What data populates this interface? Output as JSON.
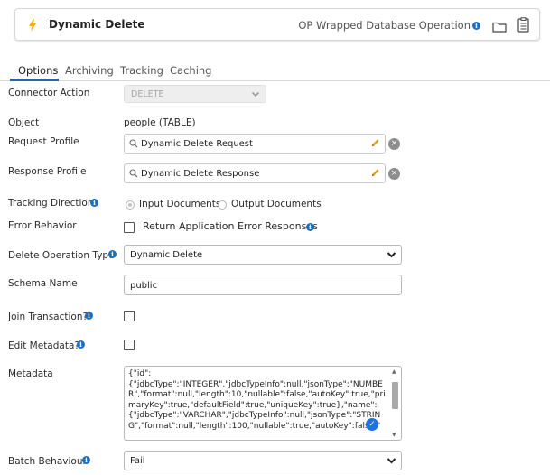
{
  "header": {
    "title": "Dynamic Delete",
    "subtitle": "OP Wrapped Database Operation",
    "icons": [
      "lightning-bolt-icon",
      "info-icon",
      "folder-icon",
      "clipboard-icon"
    ]
  },
  "tabs": [
    {
      "label": "Options",
      "active": true
    },
    {
      "label": "Archiving",
      "active": false
    },
    {
      "label": "Tracking",
      "active": false
    },
    {
      "label": "Caching",
      "active": false
    }
  ],
  "fields": {
    "connector_action": {
      "label": "Connector Action",
      "value": "DELETE"
    },
    "object": {
      "label": "Object",
      "value": "people (TABLE)"
    },
    "request_profile": {
      "label": "Request Profile",
      "value": "Dynamic Delete Request"
    },
    "response_profile": {
      "label": "Response Profile",
      "value": "Dynamic Delete Response"
    },
    "tracking_direction": {
      "label": "Tracking Direction",
      "options": [
        "Input Documents",
        "Output Documents"
      ],
      "selected": "Input Documents"
    },
    "error_behavior": {
      "label": "Error Behavior",
      "checkbox_label": "Return Application Error Responses",
      "checked": false
    },
    "delete_operation_type": {
      "label": "Delete Operation Type",
      "value": "Dynamic Delete"
    },
    "schema_name": {
      "label": "Schema Name",
      "value": "public"
    },
    "join_transaction": {
      "label": "Join Transaction?",
      "checked": false
    },
    "edit_metadata": {
      "label": "Edit Metadata?",
      "checked": false
    },
    "metadata": {
      "label": "Metadata",
      "value": "{\"id\":\n{\"jdbcType\":\"INTEGER\",\"jdbcTypeInfo\":null,\"jsonType\":\"NUMBER\",\"format\":null,\"length\":10,\"nullable\":false,\"autoKey\":true,\"primaryKey\":true,\"defaultField\":true,\"uniqueKey\":true},\"name\":\n{\"jdbcType\":\"VARCHAR\",\"jdbcTypeInfo\":null,\"jsonType\":\"STRING\",\"format\":null,\"length\":100,\"nullable\":true,\"autoKey\":false,\""
    },
    "batch_behaviour": {
      "label": "Batch Behaviour",
      "value": "Fail"
    }
  },
  "colors": {
    "accent": "#2563b0",
    "bolt": "#f3b000",
    "info": "#1f6fbf"
  }
}
